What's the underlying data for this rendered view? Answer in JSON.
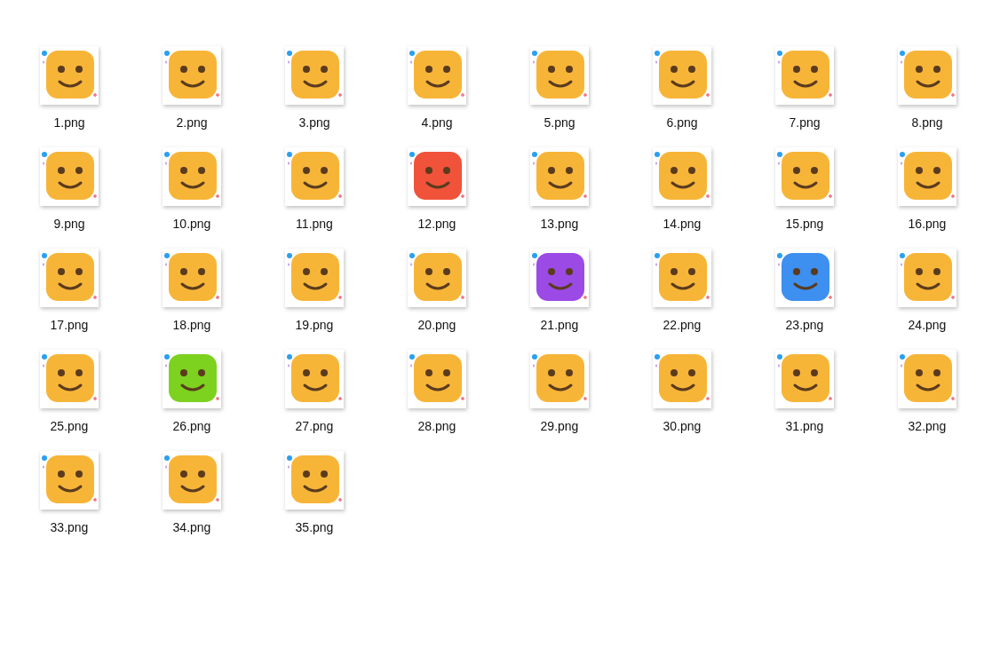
{
  "files": [
    {
      "name": "1.png",
      "color": "#f7b538"
    },
    {
      "name": "2.png",
      "color": "#f7b538"
    },
    {
      "name": "3.png",
      "color": "#f7b538"
    },
    {
      "name": "4.png",
      "color": "#f7b538"
    },
    {
      "name": "5.png",
      "color": "#f7b538"
    },
    {
      "name": "6.png",
      "color": "#f7b538"
    },
    {
      "name": "7.png",
      "color": "#f7b538"
    },
    {
      "name": "8.png",
      "color": "#f7b538"
    },
    {
      "name": "9.png",
      "color": "#f7b538"
    },
    {
      "name": "10.png",
      "color": "#f7b538"
    },
    {
      "name": "11.png",
      "color": "#f7b538"
    },
    {
      "name": "12.png",
      "color": "#f0533a"
    },
    {
      "name": "13.png",
      "color": "#f7b538"
    },
    {
      "name": "14.png",
      "color": "#f7b538"
    },
    {
      "name": "15.png",
      "color": "#f7b538"
    },
    {
      "name": "16.png",
      "color": "#f7b538"
    },
    {
      "name": "17.png",
      "color": "#f7b538"
    },
    {
      "name": "18.png",
      "color": "#f7b538"
    },
    {
      "name": "19.png",
      "color": "#f7b538"
    },
    {
      "name": "20.png",
      "color": "#f7b538"
    },
    {
      "name": "21.png",
      "color": "#9b4ae6"
    },
    {
      "name": "22.png",
      "color": "#f7b538"
    },
    {
      "name": "23.png",
      "color": "#3d8ff0"
    },
    {
      "name": "24.png",
      "color": "#f7b538"
    },
    {
      "name": "25.png",
      "color": "#f7b538"
    },
    {
      "name": "26.png",
      "color": "#7dd11f"
    },
    {
      "name": "27.png",
      "color": "#f7b538"
    },
    {
      "name": "28.png",
      "color": "#f7b538"
    },
    {
      "name": "29.png",
      "color": "#f7b538"
    },
    {
      "name": "30.png",
      "color": "#f7b538"
    },
    {
      "name": "31.png",
      "color": "#f7b538"
    },
    {
      "name": "32.png",
      "color": "#f7b538"
    },
    {
      "name": "33.png",
      "color": "#f7b538"
    },
    {
      "name": "34.png",
      "color": "#f7b538"
    },
    {
      "name": "35.png",
      "color": "#f7b538"
    }
  ]
}
